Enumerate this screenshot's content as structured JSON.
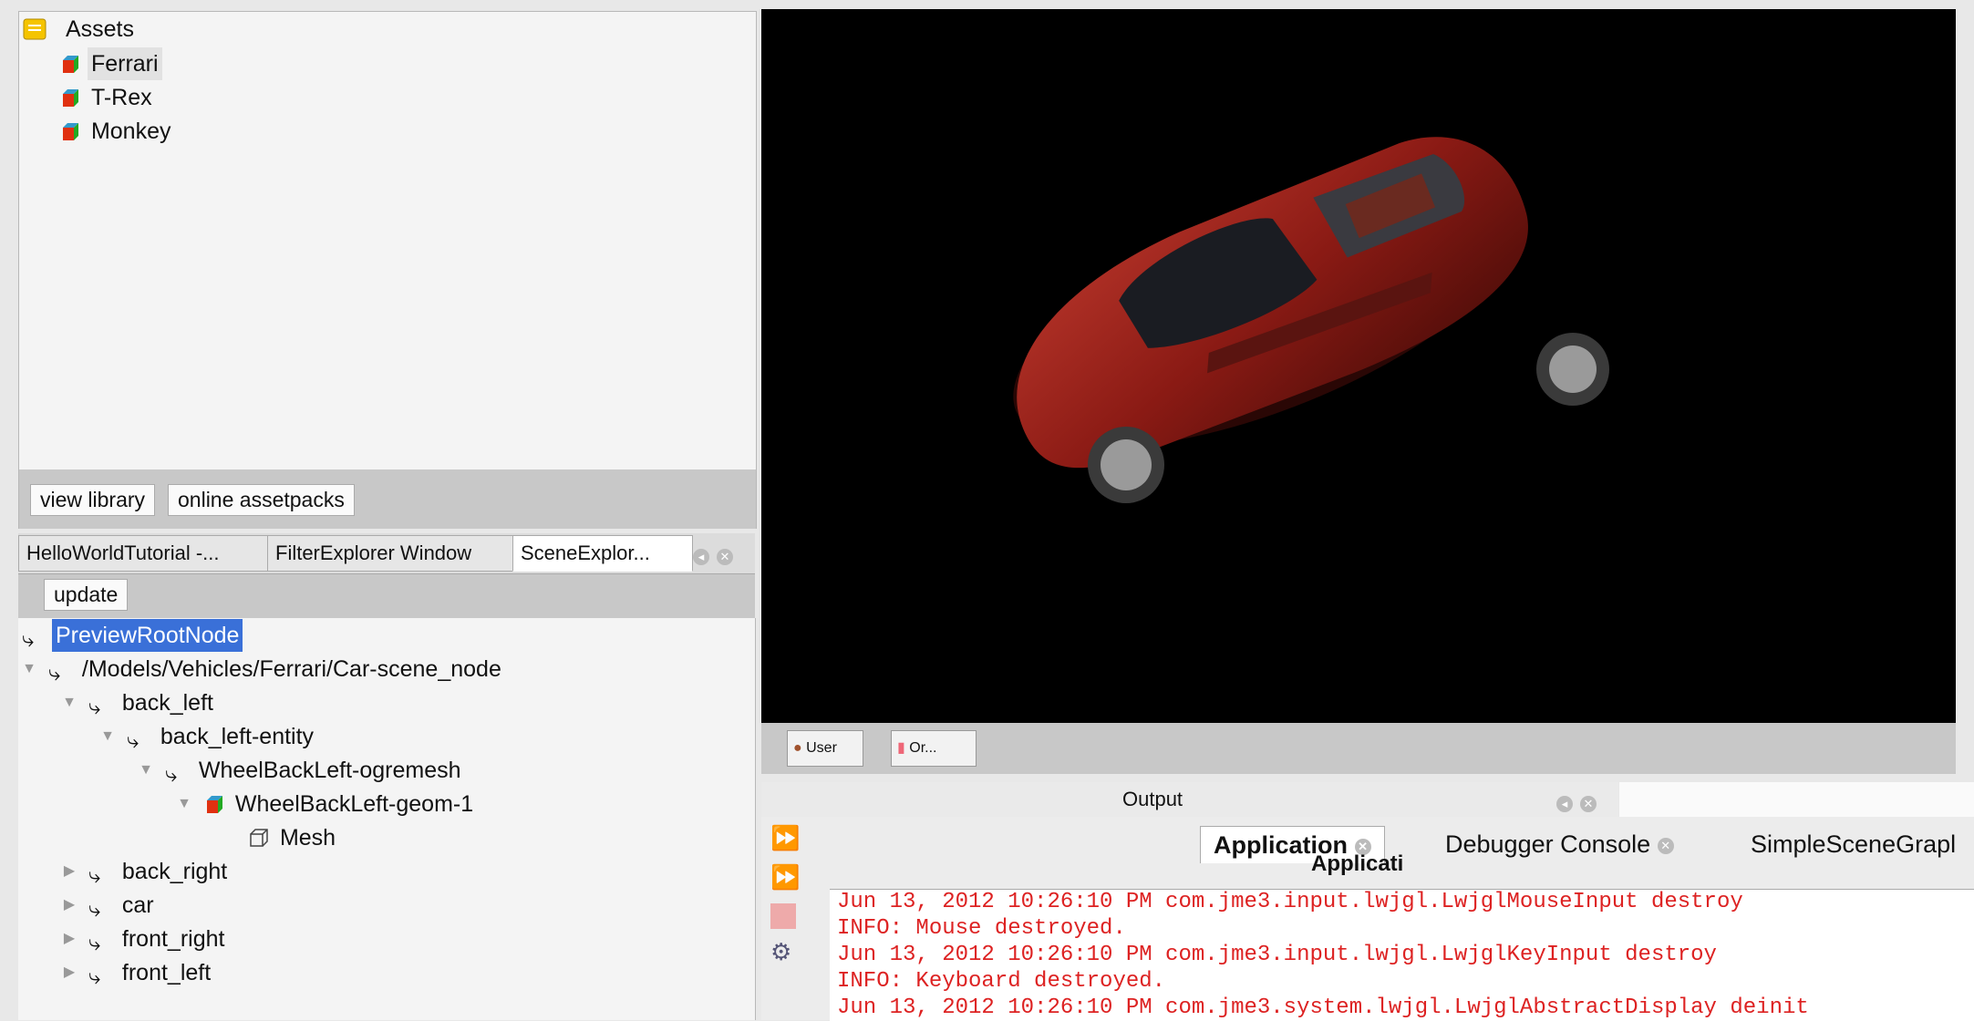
{
  "assets": {
    "root_label": "Assets",
    "items": [
      {
        "label": "Ferrari"
      },
      {
        "label": "T-Rex"
      },
      {
        "label": "Monkey"
      }
    ],
    "buttons": {
      "view_library": "view library",
      "online_assetpacks": "online assetpacks"
    }
  },
  "left_tabs": [
    {
      "label": "HelloWorldTutorial -..."
    },
    {
      "label": "FilterExplorer Window"
    },
    {
      "label": "SceneExplor..."
    }
  ],
  "scene_explorer": {
    "update_label": "update",
    "nodes": [
      {
        "label": "PreviewRootNode"
      },
      {
        "label": "/Models/Vehicles/Ferrari/Car-scene_node"
      },
      {
        "label": "back_left"
      },
      {
        "label": "back_left-entity"
      },
      {
        "label": "WheelBackLeft-ogremesh"
      },
      {
        "label": "WheelBackLeft-geom-1"
      },
      {
        "label": "Mesh"
      },
      {
        "label": "back_right"
      },
      {
        "label": "car"
      },
      {
        "label": "front_right"
      },
      {
        "label": "front_left"
      }
    ]
  },
  "viewport_tabs": {
    "user": "User",
    "other": "Or..."
  },
  "output": {
    "title": "Output",
    "tabs": [
      {
        "label": "Application"
      },
      {
        "label": "Debugger Console"
      },
      {
        "label": "SimpleSceneGrapl"
      }
    ],
    "overlap_label": "Applicati",
    "lines": [
      "Jun 13, 2012 10:26:10 PM com.jme3.input.lwjgl.LwjglMouseInput destroy",
      "INFO: Mouse destroyed.",
      "Jun 13, 2012 10:26:10 PM com.jme3.input.lwjgl.LwjglKeyInput destroy",
      "INFO: Keyboard destroyed.",
      "Jun 13, 2012 10:26:10 PM com.jme3.system.lwjgl.LwjglAbstractDisplay deinit"
    ]
  },
  "colors": {
    "selection": "#3a70d8",
    "log_text": "#d22222",
    "car_red": "#8a1a14"
  }
}
